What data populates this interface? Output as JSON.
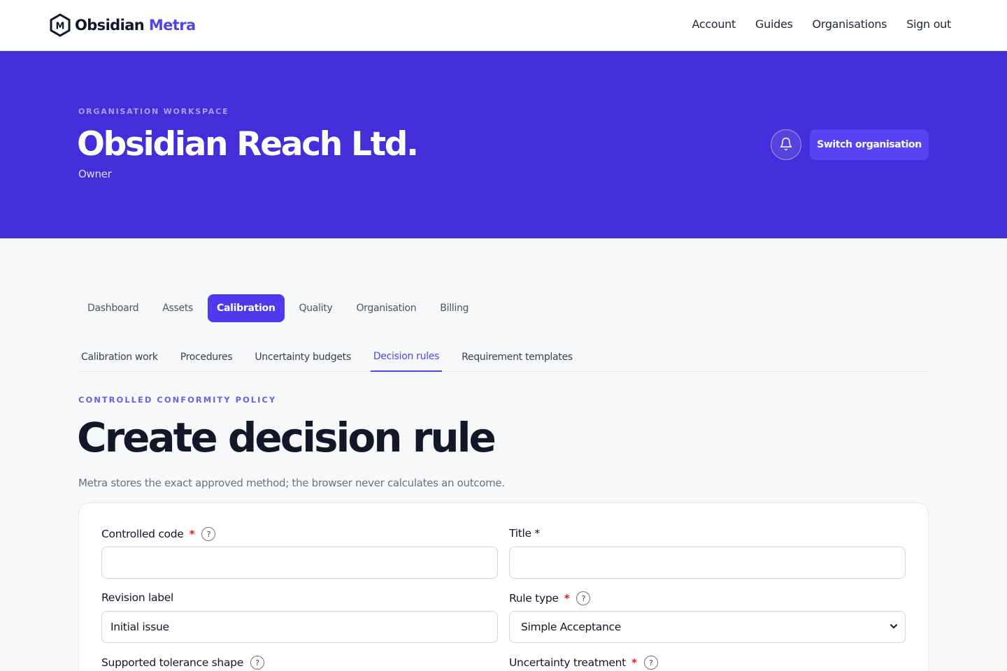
{
  "brand": {
    "name_main": "Obsidian",
    "name_accent": "Metra",
    "logo_letter": "M"
  },
  "nav": {
    "links": [
      "Account",
      "Guides",
      "Organisations",
      "Sign out"
    ]
  },
  "hero": {
    "eyebrow": "ORGANISATION WORKSPACE",
    "title": "Obsidian Reach Ltd.",
    "role": "Owner",
    "switch_label": "Switch organisation"
  },
  "tabs": [
    "Dashboard",
    "Assets",
    "Calibration",
    "Quality",
    "Organisation",
    "Billing"
  ],
  "active_tab": "Calibration",
  "subtabs": [
    "Calibration work",
    "Procedures",
    "Uncertainty budgets",
    "Decision rules",
    "Requirement templates"
  ],
  "active_subtab": "Decision rules",
  "page": {
    "eyebrow": "CONTROLLED CONFORMITY POLICY",
    "title": "Create decision rule",
    "subtitle": "Metra stores the exact approved method; the browser never calculates an outcome."
  },
  "form": {
    "controlled_code": {
      "label": "Controlled code",
      "required": "*",
      "help": "?",
      "value": ""
    },
    "title": {
      "label": "Title *",
      "value": ""
    },
    "revision_label": {
      "label": "Revision label",
      "value": "Initial issue"
    },
    "rule_type": {
      "label": "Rule type",
      "required": "*",
      "help": "?",
      "value": "Simple Acceptance"
    },
    "tolerance_shape": {
      "label": "Supported tolerance shape",
      "help": "?"
    },
    "uncertainty_treatment": {
      "label": "Uncertainty treatment",
      "required": "*",
      "help": "?"
    }
  },
  "colors": {
    "brand": "#442ed9",
    "accent": "#4f46e5",
    "required": "#dc2626"
  }
}
